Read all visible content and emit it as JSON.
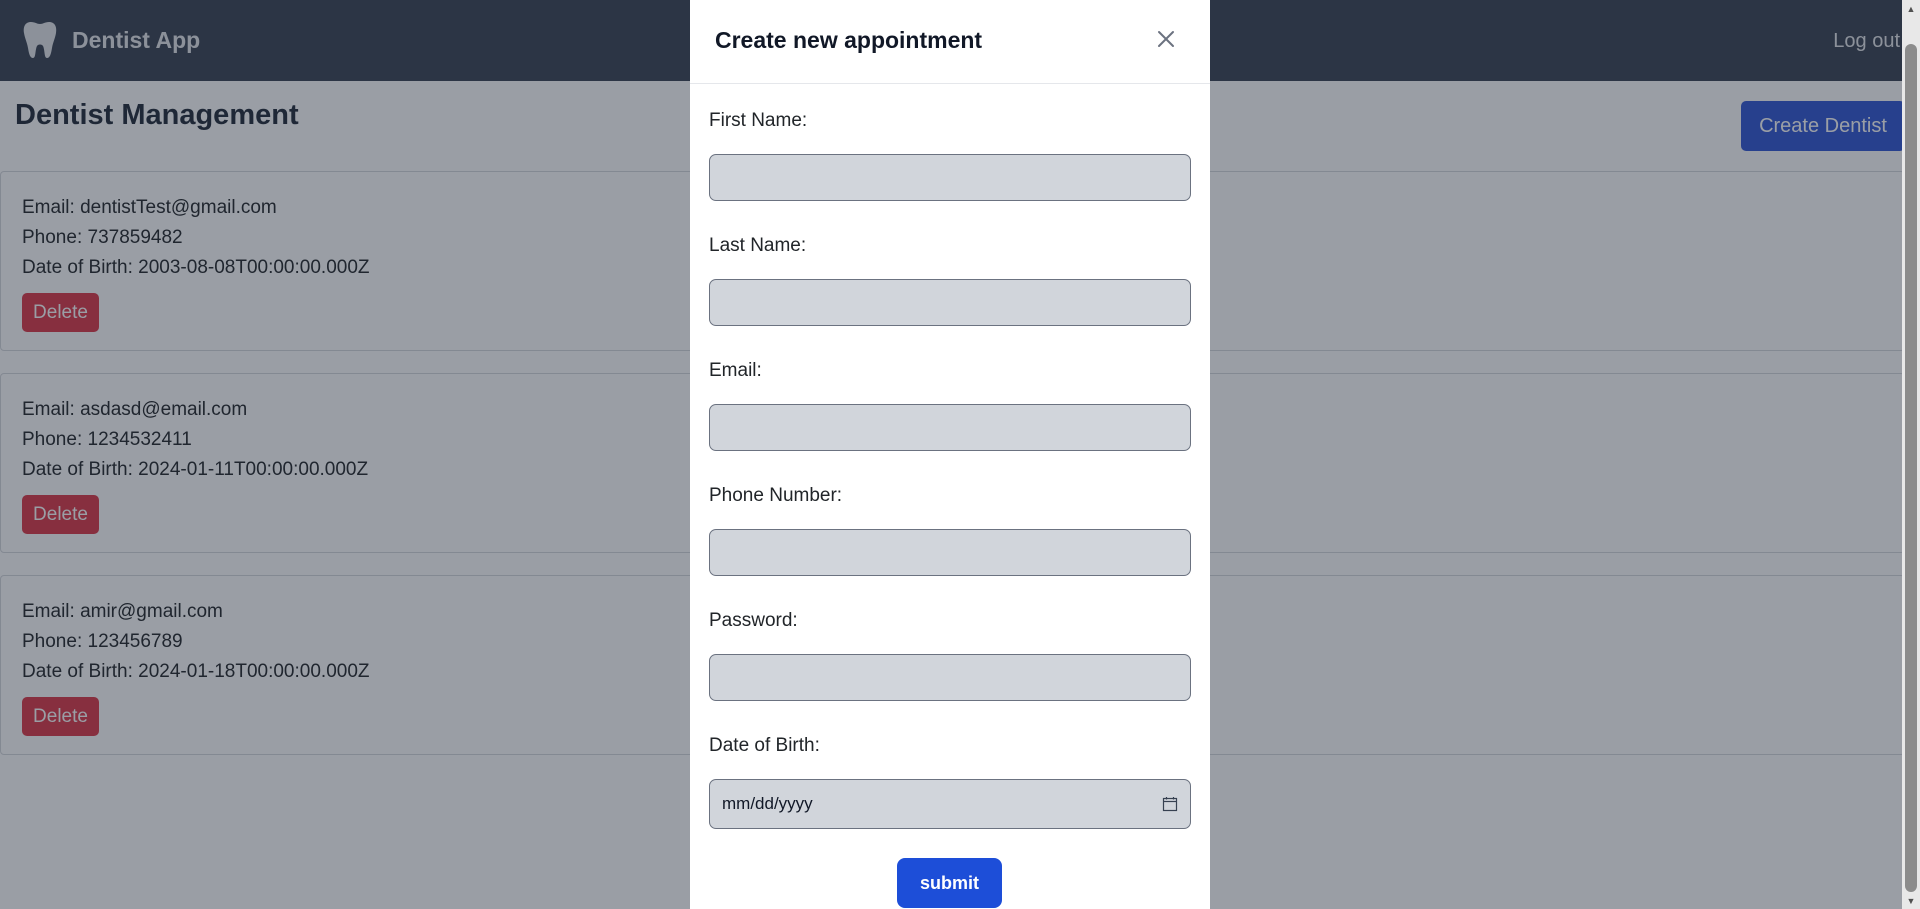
{
  "navbar": {
    "brand": "Dentist App",
    "logout": "Log out"
  },
  "page": {
    "title": "Dentist Management",
    "create_button": "Create Dentist"
  },
  "dentists": [
    {
      "email": "Email: dentistTest@gmail.com",
      "phone": "Phone: 737859482",
      "dob": "Date of Birth: 2003-08-08T00:00:00.000Z",
      "delete_label": "Delete"
    },
    {
      "email": "Email: asdasd@email.com",
      "phone": "Phone: 1234532411",
      "dob": "Date of Birth: 2024-01-11T00:00:00.000Z",
      "delete_label": "Delete"
    },
    {
      "email": "Email: amir@gmail.com",
      "phone": "Phone: 123456789",
      "dob": "Date of Birth: 2024-01-18T00:00:00.000Z",
      "delete_label": "Delete"
    }
  ],
  "modal": {
    "title": "Create new appointment",
    "fields": [
      {
        "label": "First Name:",
        "value": ""
      },
      {
        "label": "Last Name:",
        "value": ""
      },
      {
        "label": "Email:",
        "value": ""
      },
      {
        "label": "Phone Number:",
        "value": ""
      },
      {
        "label": "Password:",
        "value": ""
      }
    ],
    "dob_label": "Date of Birth:",
    "dob_placeholder": "mm/dd/yyyy",
    "submit_label": "submit"
  },
  "colors": {
    "navbar": "#374151",
    "primary_button": "#2f55d4",
    "submit_button": "#1d4ed8",
    "delete_button": "#dc3545",
    "input_bg": "#d1d5db"
  },
  "icons": {
    "brand": "tooth-icon",
    "close": "close-icon",
    "calendar": "calendar-icon"
  }
}
